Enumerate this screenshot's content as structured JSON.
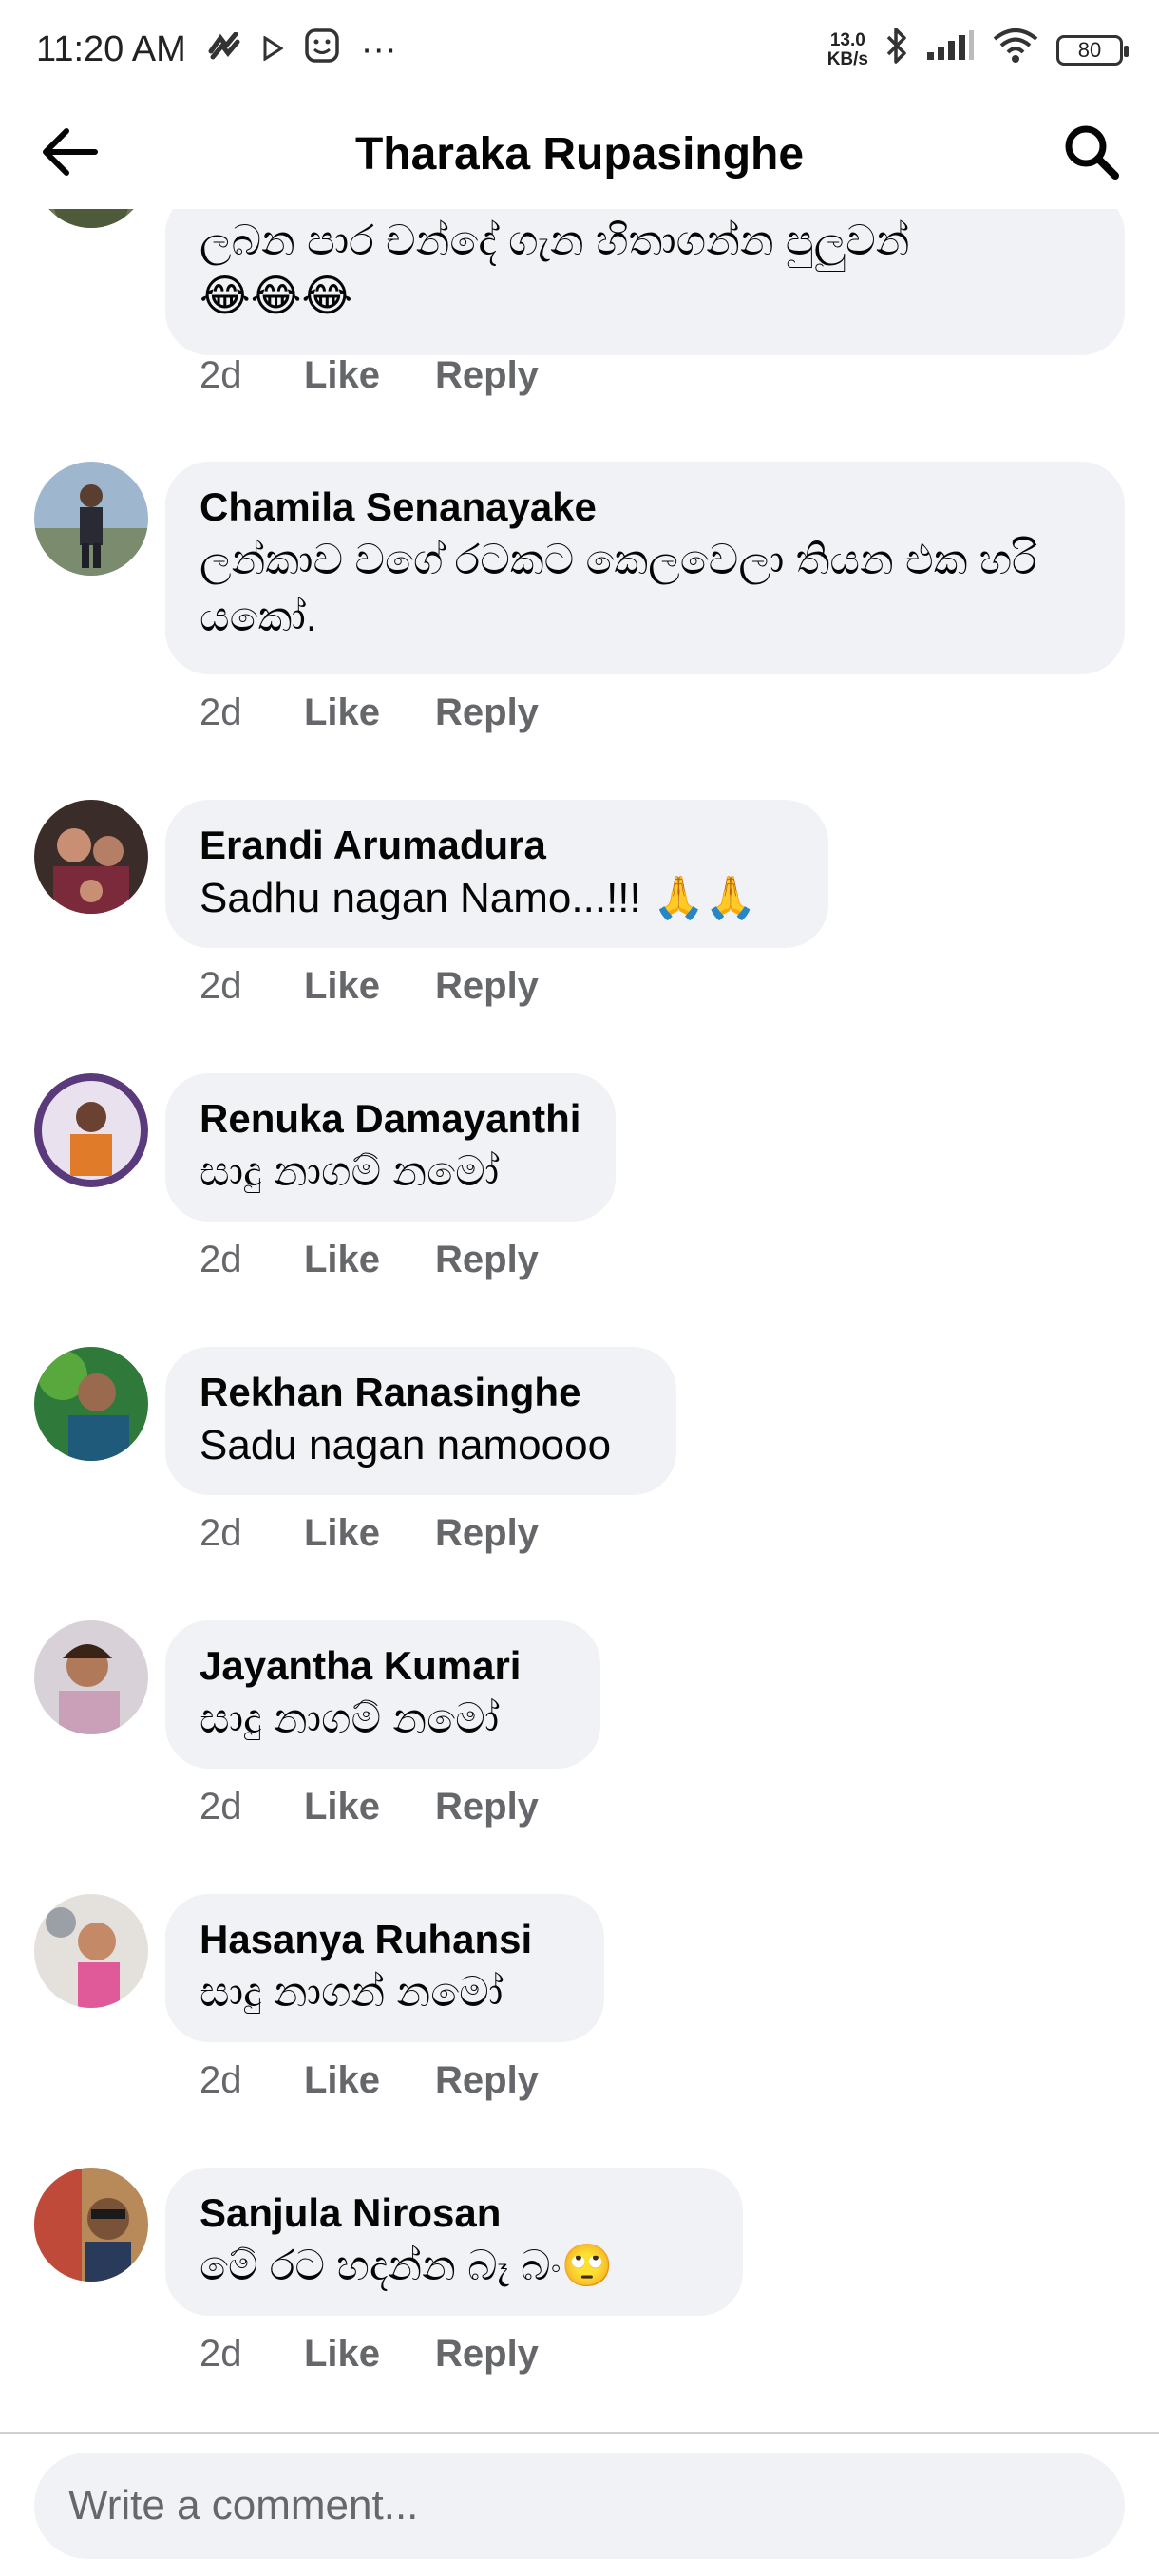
{
  "status_bar": {
    "time": "11:20 AM",
    "dots": "···",
    "net_speed_value": "13.0",
    "net_speed_unit": "KB/s",
    "battery": "80"
  },
  "header": {
    "title": "Tharaka Rupasinghe"
  },
  "comments": [
    {
      "author": "",
      "text": "ලබන පාර චන්දේ ගැන හිතාගන්න පුලුවන්",
      "emoji": "😂😂😂",
      "time": "2d",
      "like": "Like",
      "reply": "Reply"
    },
    {
      "author": "Chamila Senanayake",
      "text": "ලන්කාව වගේ රටකට කෙලවෙලා තියන එක හරි යකෝ.",
      "time": "2d",
      "like": "Like",
      "reply": "Reply"
    },
    {
      "author": "Erandi Arumadura",
      "text": "Sadhu nagan Namo...!!!",
      "emoji": "🙏🙏",
      "time": "2d",
      "like": "Like",
      "reply": "Reply"
    },
    {
      "author": "Renuka Damayanthi",
      "text": "සාදු නාගම් නමෝ",
      "time": "2d",
      "like": "Like",
      "reply": "Reply"
    },
    {
      "author": "Rekhan Ranasinghe",
      "text": "Sadu nagan namoooo",
      "time": "2d",
      "like": "Like",
      "reply": "Reply"
    },
    {
      "author": "Jayantha Kumari",
      "text": "සාදු නාගම් නමෝ",
      "time": "2d",
      "like": "Like",
      "reply": "Reply"
    },
    {
      "author": "Hasanya Ruhansi",
      "text": "සාදු නාගන් නමෝ",
      "time": "2d",
      "like": "Like",
      "reply": "Reply"
    },
    {
      "author": "Sanjula Nirosan",
      "text": "මේ රට හදන්න බෑ බං",
      "emoji": "🙄",
      "time": "2d",
      "like": "Like",
      "reply": "Reply"
    }
  ],
  "footer": {
    "placeholder": "Write a comment..."
  },
  "icons": {
    "back": "arrow-left-icon",
    "search": "search-icon"
  },
  "colors": {
    "bubble": "#f0f2f5",
    "meta_text": "#65676b",
    "text": "#050505"
  }
}
